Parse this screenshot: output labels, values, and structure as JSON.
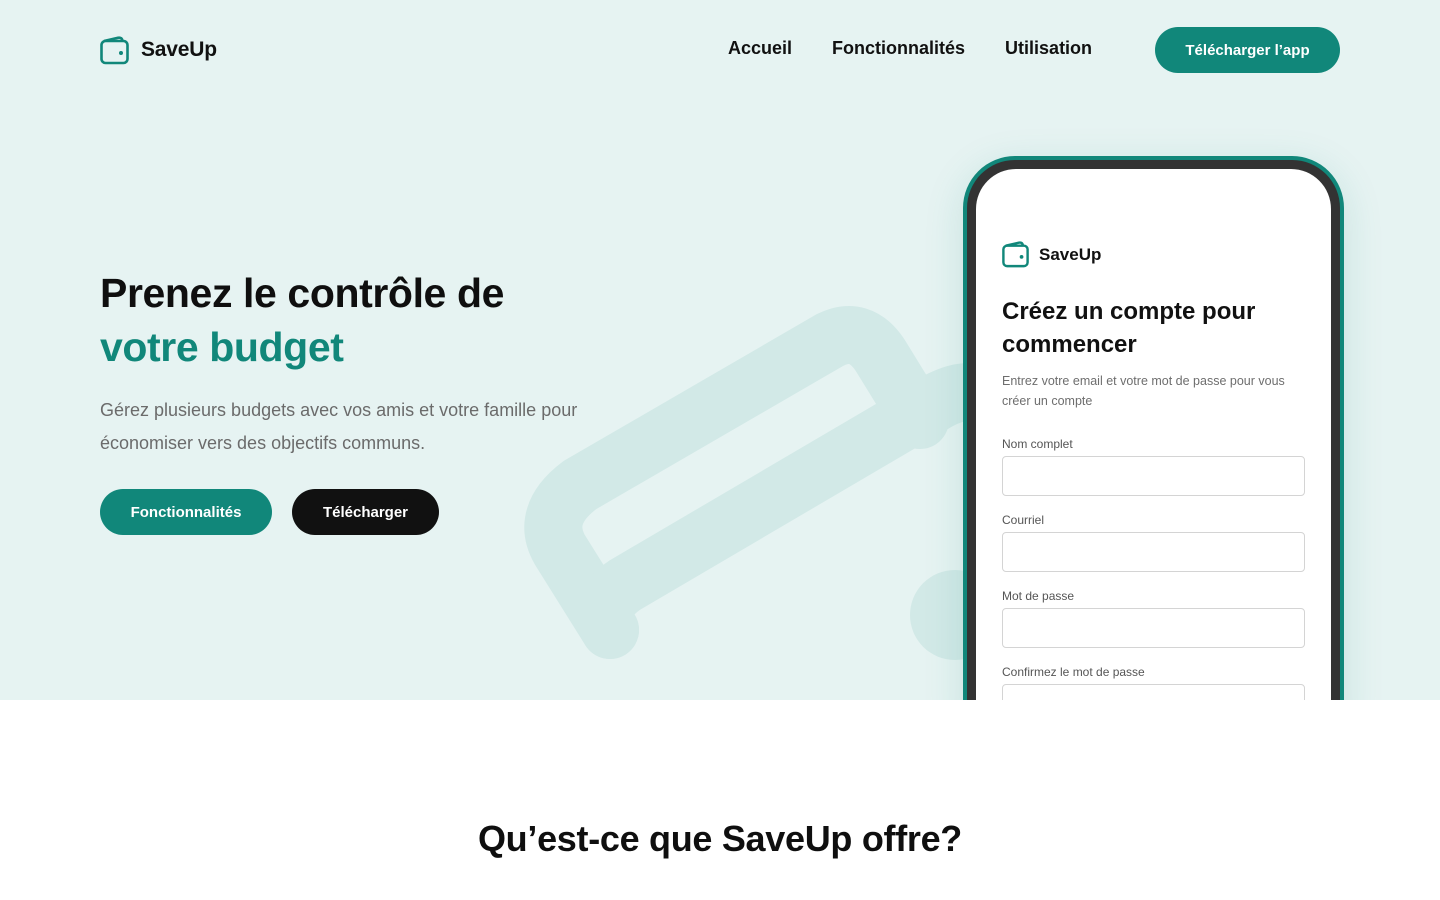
{
  "brand": {
    "name": "SaveUp",
    "accent_color": "#11877a",
    "dark_color": "#111111",
    "hero_bg": "#e6f3f2"
  },
  "nav": {
    "logo_icon": "wallet-icon",
    "links": [
      "Accueil",
      "Fonctionnalités",
      "Utilisation"
    ],
    "cta_label": "Télécharger l’app"
  },
  "hero": {
    "title_line1": "Prenez le contrôle de",
    "title_line2": "votre budget",
    "subtitle": "Gérez plusieurs budgets avec vos amis et votre famille pour économiser vers des objectifs communs.",
    "primary_button": "Fonctionnalités",
    "secondary_button": "Télécharger",
    "background_icon": "wallet-icon"
  },
  "phone": {
    "app_name": "SaveUp",
    "logo_icon": "wallet-icon",
    "title": "Créez un compte pour commencer",
    "subtitle": "Entrez votre email et votre mot de passe pour vous créer un compte",
    "fields": [
      {
        "label": "Nom complet",
        "value": ""
      },
      {
        "label": "Courriel",
        "value": ""
      },
      {
        "label": "Mot de passe",
        "value": ""
      },
      {
        "label": "Confirmez le mot de passe",
        "value": ""
      }
    ]
  },
  "section": {
    "title": "Qu’est-ce que SaveUp offre?"
  }
}
